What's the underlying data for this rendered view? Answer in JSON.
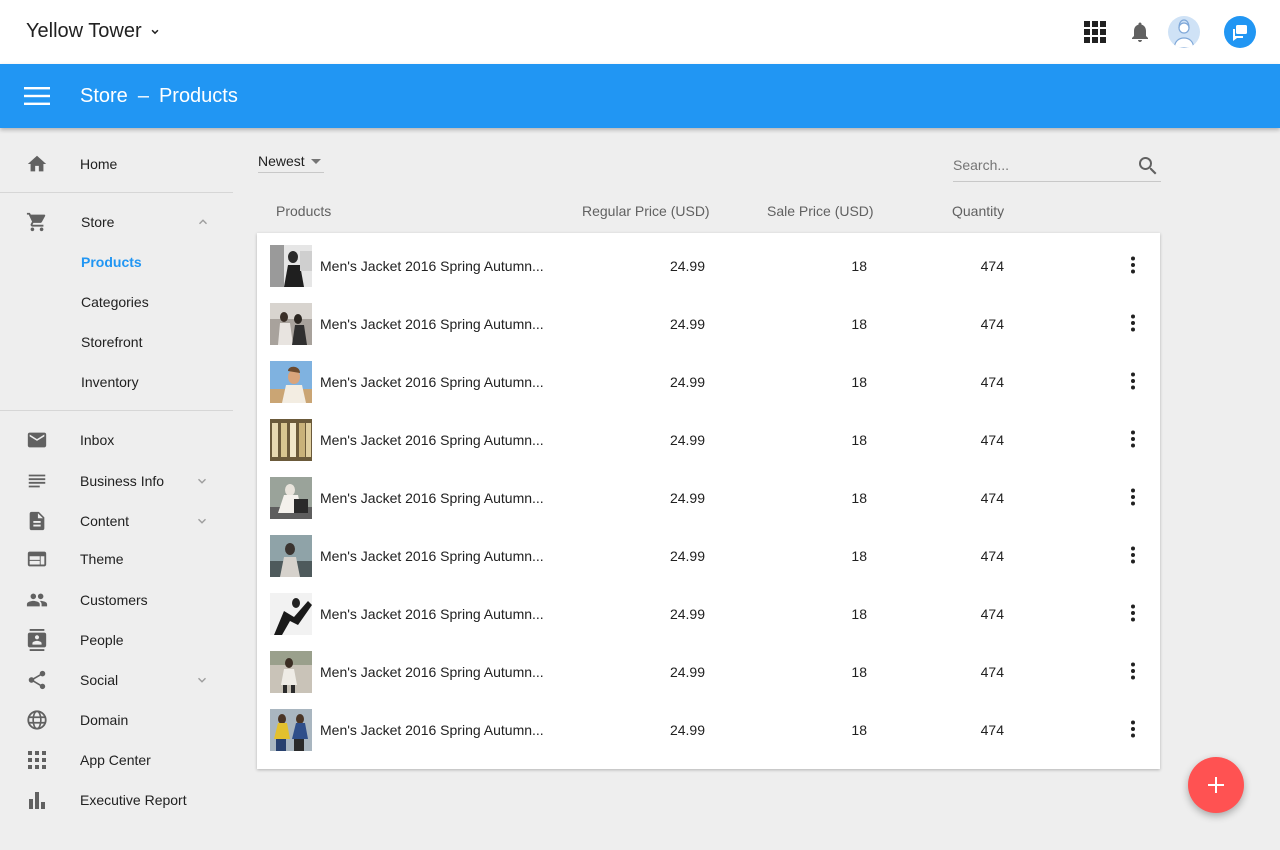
{
  "site": {
    "name": "Yellow Tower"
  },
  "top_icons": [
    "apps-grid-icon",
    "bell-icon",
    "avatar",
    "chat-icon"
  ],
  "appbar": {
    "section": "Store",
    "separator": "–",
    "page": "Products"
  },
  "sidebar": {
    "home": "Home",
    "store": {
      "label": "Store",
      "expanded": true,
      "children": [
        "Products",
        "Categories",
        "Storefront",
        "Inventory"
      ],
      "active_child": "Products"
    },
    "items": [
      "Inbox",
      "Business Info",
      "Content",
      "Theme",
      "Customers",
      "People",
      "Social",
      "Domain",
      "App Center",
      "Executive Report"
    ]
  },
  "toolbar": {
    "sort_value": "Newest",
    "search_placeholder": "Search..."
  },
  "table": {
    "headers": [
      "Products",
      "Regular Price (USD)",
      "Sale Price (USD)",
      "Quantity"
    ],
    "rows": [
      {
        "name": "Men's Jacket 2016 Spring Autumn...",
        "regular": "24.99",
        "sale": "18",
        "qty": "474"
      },
      {
        "name": "Men's Jacket 2016 Spring Autumn...",
        "regular": "24.99",
        "sale": "18",
        "qty": "474"
      },
      {
        "name": "Men's Jacket 2016 Spring Autumn...",
        "regular": "24.99",
        "sale": "18",
        "qty": "474"
      },
      {
        "name": "Men's Jacket 2016 Spring Autumn...",
        "regular": "24.99",
        "sale": "18",
        "qty": "474"
      },
      {
        "name": "Men's Jacket 2016 Spring Autumn...",
        "regular": "24.99",
        "sale": "18",
        "qty": "474"
      },
      {
        "name": "Men's Jacket 2016 Spring Autumn...",
        "regular": "24.99",
        "sale": "18",
        "qty": "474"
      },
      {
        "name": "Men's Jacket 2016 Spring Autumn...",
        "regular": "24.99",
        "sale": "18",
        "qty": "474"
      },
      {
        "name": "Men's Jacket 2016 Spring Autumn...",
        "regular": "24.99",
        "sale": "18",
        "qty": "474"
      },
      {
        "name": "Men's Jacket 2016 Spring Autumn...",
        "regular": "24.99",
        "sale": "18",
        "qty": "474"
      }
    ]
  },
  "fab": {
    "icon": "add-icon"
  },
  "colors": {
    "primary": "#2196f3",
    "fab": "#ff5252",
    "background": "#eeeeee"
  }
}
